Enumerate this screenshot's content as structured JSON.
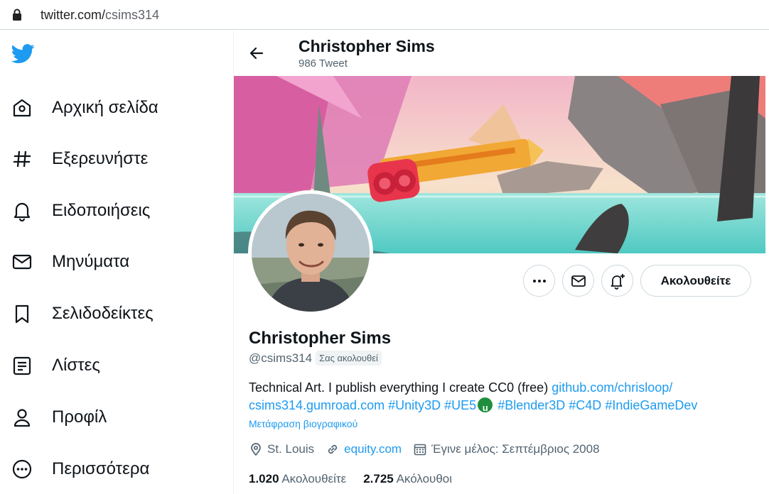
{
  "browser": {
    "url_domain": "twitter.com/",
    "url_path": "csims314"
  },
  "nav": {
    "items": [
      {
        "label": "Αρχική σελίδα",
        "icon": "home-icon"
      },
      {
        "label": "Εξερευνήστε",
        "icon": "hashtag-icon"
      },
      {
        "label": "Ειδοποιήσεις",
        "icon": "bell-icon"
      },
      {
        "label": "Μηνύματα",
        "icon": "mail-icon"
      },
      {
        "label": "Σελιδοδείκτες",
        "icon": "bookmark-icon"
      },
      {
        "label": "Λίστες",
        "icon": "list-icon"
      },
      {
        "label": "Προφίλ",
        "icon": "person-icon"
      },
      {
        "label": "Περισσότερα",
        "icon": "more-icon"
      }
    ]
  },
  "header": {
    "name": "Christopher Sims",
    "tweet_count": "986 Tweet"
  },
  "profile": {
    "name": "Christopher Sims",
    "handle": "@csims314",
    "follows_you": "Σας ακολουθεί",
    "follow_button": "Ακολουθείτε",
    "bio": {
      "text": "Technical Art. I publish everything I create CC0 (free) ",
      "link1": "github.com/chrisloop/",
      "link2": "csims314.gumroad.com",
      "tag1": "#Unity3D",
      "tag2": "#UE5",
      "ue_badge": "u",
      "tag3": "#Blender3D",
      "tag4": "#C4D",
      "tag5": "#IndieGameDev"
    },
    "translate": "Μετάφραση βιογραφικού",
    "location": "St. Louis",
    "website": "equity.com",
    "joined": "Έγινε μέλος: Σεπτέμβριος 2008",
    "following_count": "1.020",
    "following_label": "Ακολουθείτε",
    "followers_count": "2.725",
    "followers_label": "Ακόλουθοι"
  },
  "colors": {
    "accent": "#1d9bf0",
    "text": "#0f1419",
    "muted": "#536471",
    "border": "#cfd9de"
  }
}
